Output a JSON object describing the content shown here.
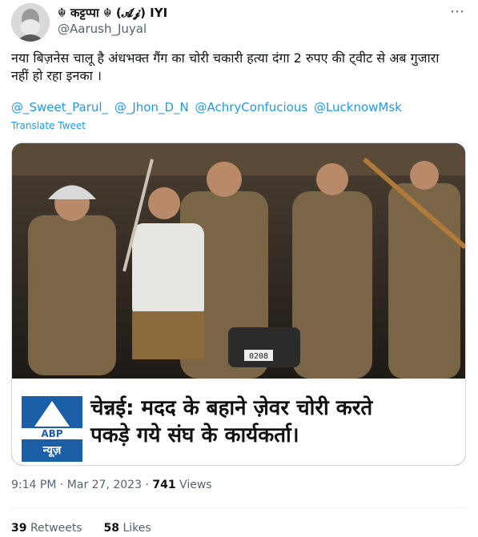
{
  "author": {
    "display_name": "☬ कट्टप्पा ☬ (𝓐𝓳) IYI",
    "handle": "@Aarush_Juyal"
  },
  "more_icon": "⋯",
  "tweet": {
    "text": "नया बिज़नेस चालू है अंधभक्त गैंग का चोरी चकारी हत्या दंगा 2 रुपए की ट्वीट से अब गुजारा नहीं हो रहा इनका ।",
    "mentions": [
      "@_Sweet_Parul_",
      "@_Jhon_D_N",
      "@AchryConfucious",
      "@LucknowMsk"
    ],
    "translate_label": "Translate Tweet"
  },
  "media": {
    "logo_text": "ABP",
    "logo_subtext": "न्यूज़",
    "headline_line1": "चेन्नई: मदद के बहाने ज़ेवर चोरी करते",
    "headline_line2": "पकड़े गये संघ के कार्यकर्ता।",
    "plate_text": "0208"
  },
  "meta": {
    "time": "9:14 PM",
    "date": "Mar 27, 2023",
    "views_count": "741",
    "views_label": "Views"
  },
  "stats": {
    "retweets_count": "39",
    "retweets_label": "Retweets",
    "likes_count": "58",
    "likes_label": "Likes"
  }
}
